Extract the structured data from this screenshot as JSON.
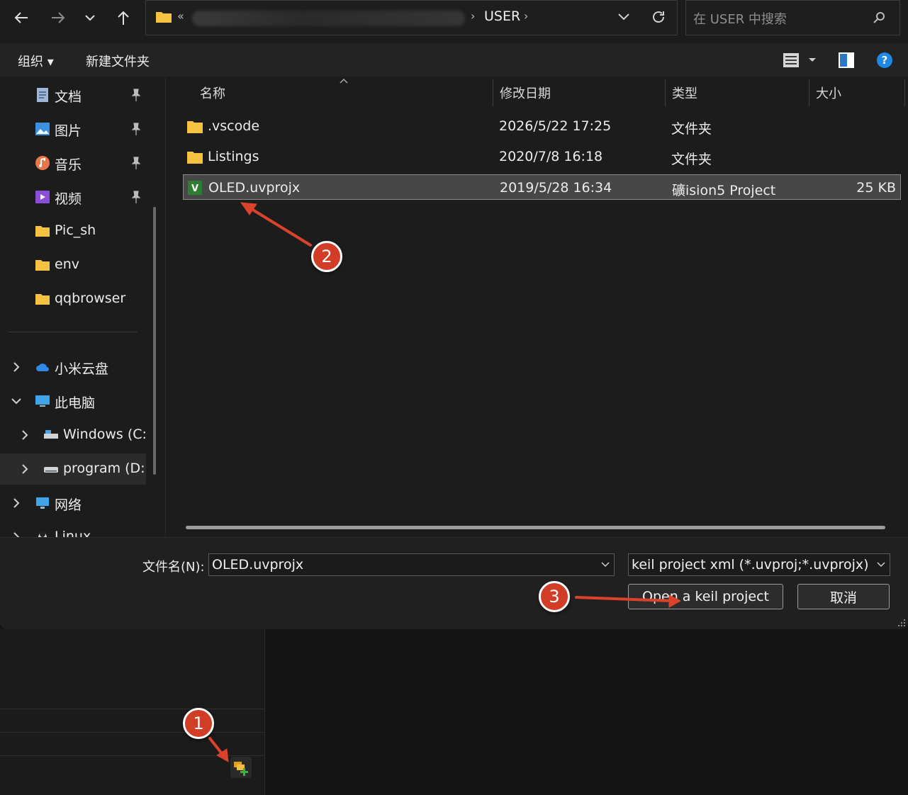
{
  "nav": {
    "back": "back-arrow",
    "forward": "forward-arrow",
    "recent": "chevron-down",
    "up": "up-arrow"
  },
  "address": {
    "prefix": "«",
    "current": "USER",
    "separator": "›"
  },
  "search": {
    "placeholder": "在 USER 中搜索"
  },
  "toolbar": {
    "organize": "组织 ▾",
    "new_folder": "新建文件夹"
  },
  "sidebar": {
    "quick": [
      {
        "label": "文档",
        "icon": "documents-icon",
        "pinned": true
      },
      {
        "label": "图片",
        "icon": "pictures-icon",
        "pinned": true
      },
      {
        "label": "音乐",
        "icon": "music-icon",
        "pinned": true
      },
      {
        "label": "视频",
        "icon": "videos-icon",
        "pinned": true
      },
      {
        "label": "Pic_sh",
        "icon": "folder-icon",
        "pinned": false
      },
      {
        "label": "env",
        "icon": "folder-icon",
        "pinned": false
      },
      {
        "label": "qqbrowser",
        "icon": "folder-icon",
        "pinned": false
      }
    ],
    "tree": [
      {
        "label": "小米云盘",
        "expanded": false
      },
      {
        "label": "此电脑",
        "expanded": true
      },
      {
        "label": "Windows (C:)",
        "expanded": false
      },
      {
        "label": "program (D:)",
        "expanded": false,
        "selected": true
      },
      {
        "label": "网络",
        "expanded": false
      },
      {
        "label": "Linux",
        "expanded": false
      }
    ]
  },
  "columns": {
    "name": "名称",
    "modified": "修改日期",
    "type": "类型",
    "size": "大小"
  },
  "files": [
    {
      "name": ".vscode",
      "modified": "2026/5/22 17:25",
      "type": "文件夹",
      "size": "",
      "kind": "folder"
    },
    {
      "name": "Listings",
      "modified": "2020/7/8 16:18",
      "type": "文件夹",
      "size": "",
      "kind": "folder"
    },
    {
      "name": "OLED.uvprojx",
      "modified": "2019/5/28 16:34",
      "type": "礦ision5 Project",
      "size": "25 KB",
      "kind": "uvprojx",
      "selected": true
    }
  ],
  "bottom": {
    "filename_label": "文件名(N):",
    "filename_value": "OLED.uvprojx",
    "filetype_value": "keil project xml (*.uvproj;*.uvprojx)",
    "open_button": "Open a keil project",
    "cancel_button": "取消"
  },
  "annotations": [
    {
      "number": "1"
    },
    {
      "number": "2"
    },
    {
      "number": "3"
    }
  ],
  "colors": {
    "badge": "#d13d26",
    "arrow": "#d9432b",
    "folder": "#f5c242"
  }
}
